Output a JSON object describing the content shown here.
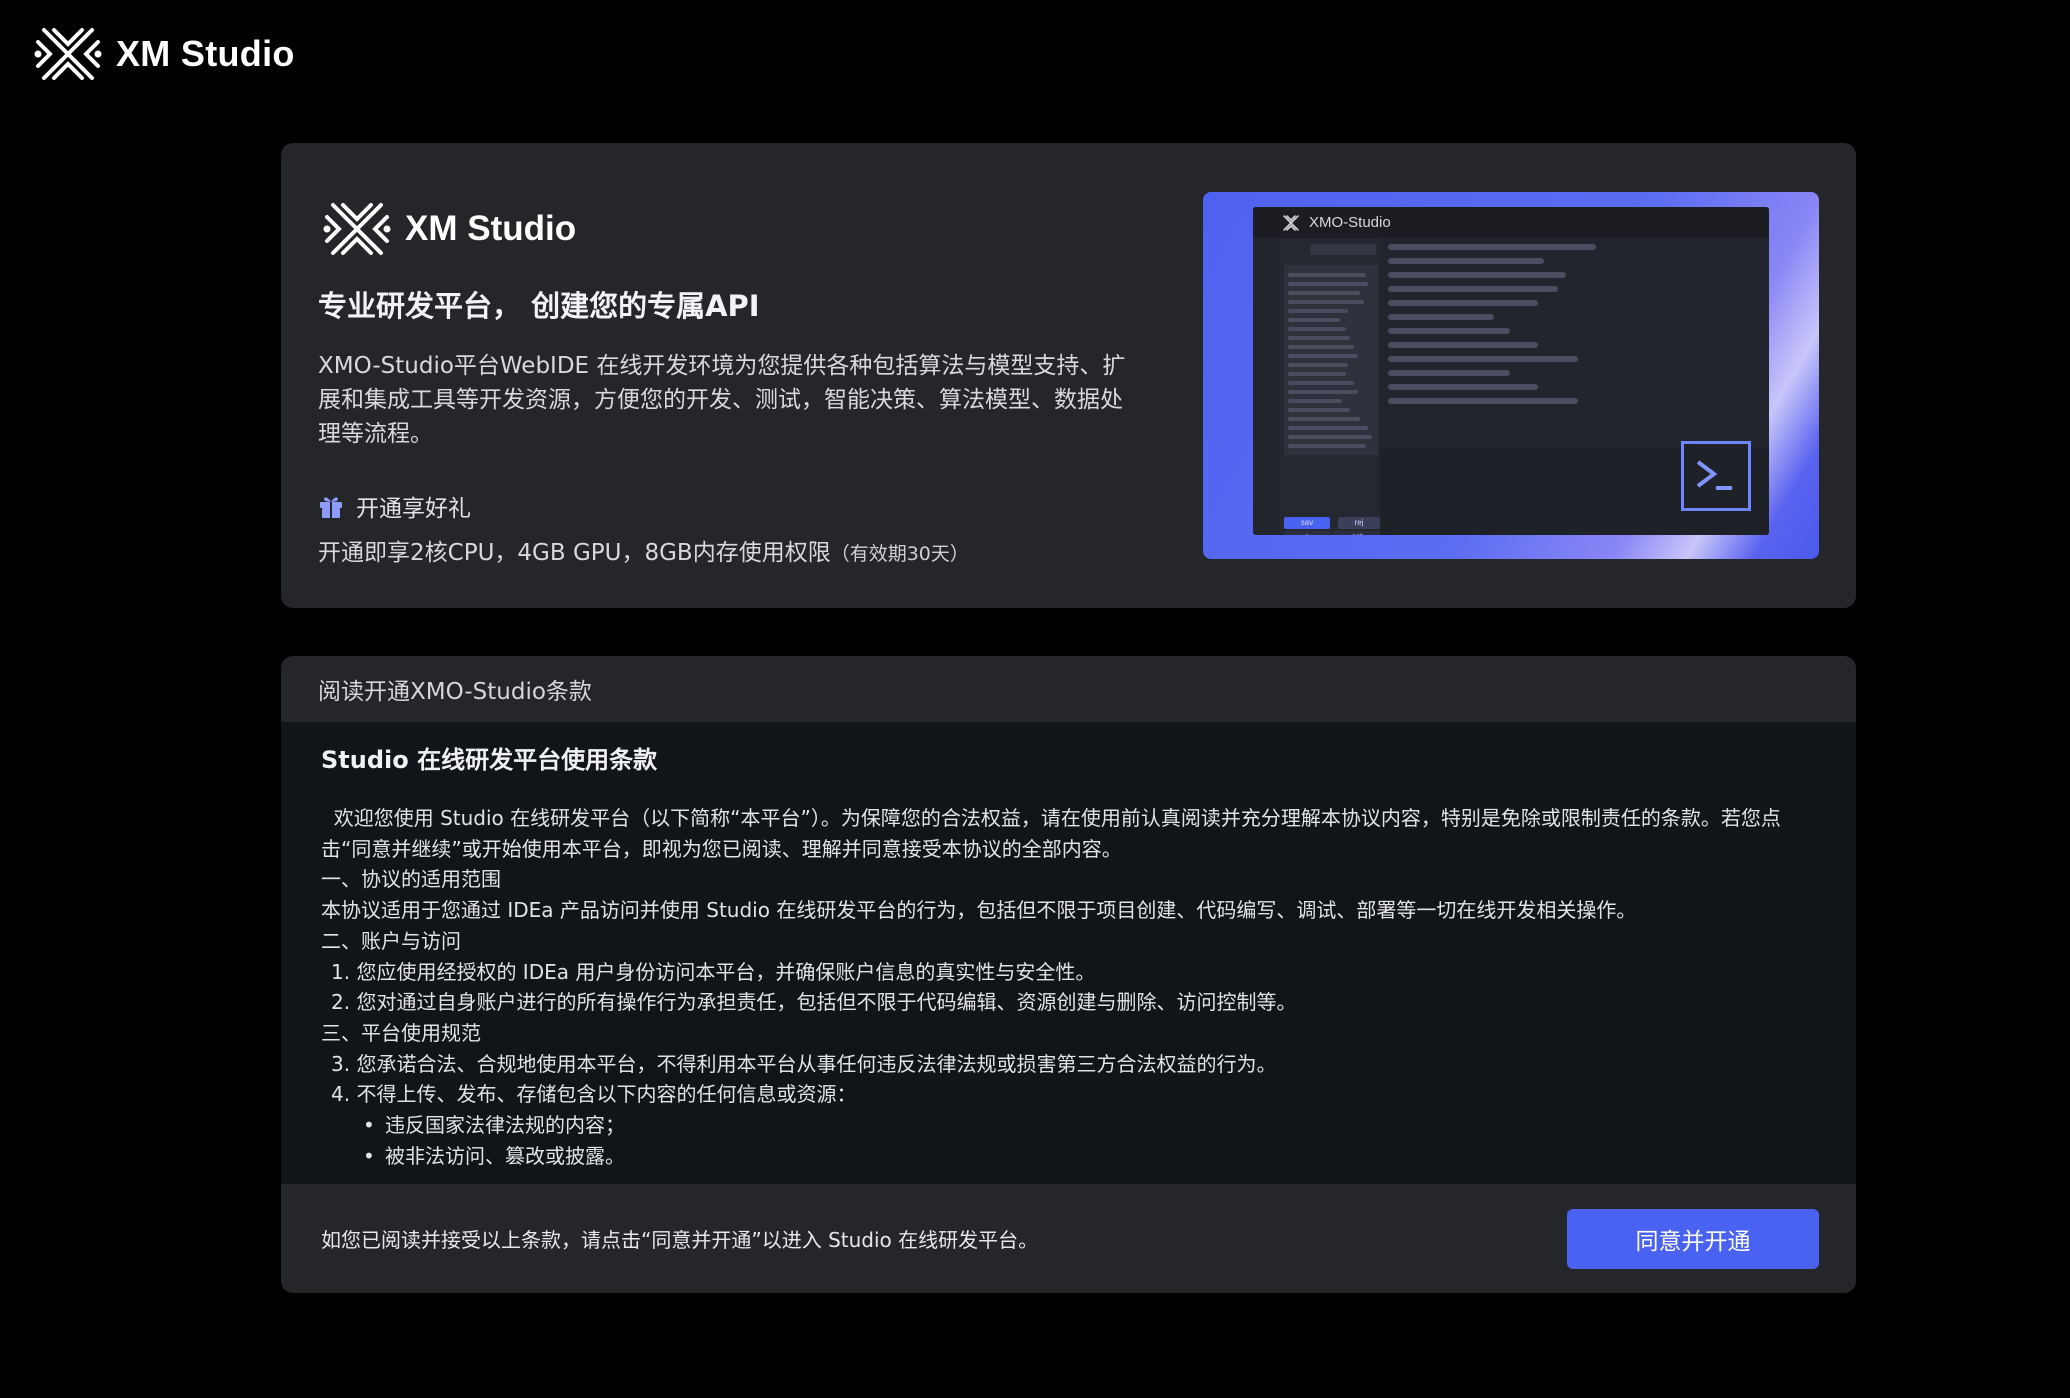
{
  "brand": {
    "name": "XM Studio"
  },
  "hero": {
    "brand_name": "XM Studio",
    "title": "专业研发平台， 创建您的专属API",
    "description": "XMO-Studio平台WebIDE 在线开发环境为您提供各种包括算法与模型支持、扩展和集成工具等开发资源，方便您的开发、测试，智能决策、算法模型、数据处理等流程。",
    "gift_label": "开通享好礼",
    "gift_desc": "开通即享2核CPU，4GB GPU，8GB内存使用权限",
    "gift_note": "（有效期30天）",
    "gift_icon": "gift-icon",
    "illustration": {
      "window_title": "XMO-Studio",
      "btn_save": "sav",
      "btn_reject": "rej",
      "btn_e": "e",
      "btn_ect": "ect"
    }
  },
  "terms": {
    "header": "阅读开通XMO-Studio条款",
    "title": "Studio 在线研发平台使用条款",
    "paragraphs": [
      "  欢迎您使用 Studio 在线研发平台（以下简称“本平台”）。为保障您的合法权益，请在使用前认真阅读并充分理解本协议内容，特别是免除或限制责任的条款。若您点击“同意并继续”或开始使用本平台，即视为您已阅读、理解并同意接受本协议的全部内容。",
      "一、协议的适用范围",
      "本协议适用于您通过 IDEa 产品访问并使用 Studio 在线研发平台的行为，包括但不限于项目创建、代码编写、调试、部署等一切在线开发相关操作。",
      "二、账户与访问",
      "1. 您应使用经授权的 IDEa 用户身份访问本平台，并确保账户信息的真实性与安全性。",
      "2. 您对通过自身账户进行的所有操作行为承担责任，包括但不限于代码编辑、资源创建与删除、访问控制等。",
      "三、平台使用规范",
      "3. 您承诺合法、合规地使用本平台，不得利用本平台从事任何违反法律法规或损害第三方合法权益的行为。",
      "4. 不得上传、发布、存储包含以下内容的任何信息或资源：",
      "违反国家法律法规的内容；",
      "被非法访问、篡改或披露。"
    ],
    "footer_text": "如您已阅读并接受以上条款，请点击“同意并开通”以进入 Studio 在线研发平台。",
    "agree_button": "同意并开通"
  },
  "colors": {
    "accent": "#4a62f2",
    "background": "#000000",
    "card": "#25262a"
  }
}
